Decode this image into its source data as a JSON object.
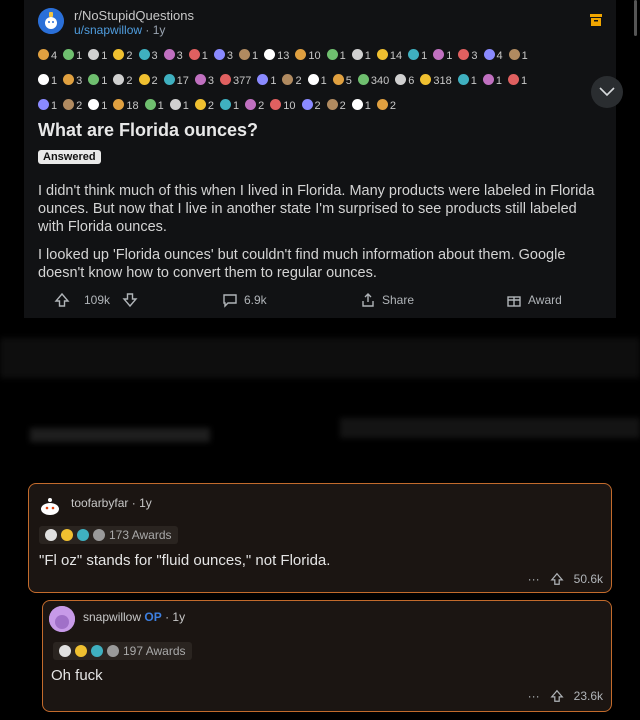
{
  "post": {
    "subreddit": "r/NoStupidQuestions",
    "username": "u/snapwillow",
    "time": "1y",
    "title": "What are Florida ounces?",
    "flair": "Answered",
    "body": [
      "I didn't think much of this when I lived in Florida. Many products were labeled in Florida ounces. But now that I live in another state I'm surprised to see products still labeled with Florida ounces.",
      "I looked up 'Florida ounces' but couldn't find much information about them. Google doesn't know how to convert them to regular ounces."
    ],
    "actions": {
      "upvotes": "109k",
      "comments": "6.9k",
      "share": "Share",
      "award": "Award"
    },
    "awards": [
      [
        "4",
        "1",
        "1",
        "2",
        "3",
        "3",
        "1",
        "3",
        "1",
        "13",
        "10",
        "1",
        "1",
        "14",
        "1",
        "1",
        "3",
        "4",
        "1"
      ],
      [
        "1",
        "3",
        "1",
        "2",
        "2",
        "17",
        "3",
        "377",
        "1",
        "2",
        "1",
        "5",
        "340",
        "6",
        "318",
        "1",
        "1",
        "1"
      ],
      [
        "1",
        "2",
        "1",
        "18",
        "1",
        "1",
        "2",
        "1",
        "2",
        "10",
        "2",
        "2",
        "1",
        "2"
      ]
    ]
  },
  "comments": [
    {
      "author": "toofarbyfar",
      "time": "1y",
      "awards": "173 Awards",
      "text": "\"Fl oz\" stands for \"fluid ounces,\" not Florida.",
      "score": "50.6k",
      "more": "···"
    },
    {
      "author": "snapwillow",
      "op": "OP",
      "time": "1y",
      "awards": "197 Awards",
      "text": "Oh fuck",
      "score": "23.6k",
      "more": "···"
    }
  ],
  "colors": {
    "accent": "#4f9dde",
    "comment_border": "#c36b2c",
    "op": "#3d7fe0"
  }
}
